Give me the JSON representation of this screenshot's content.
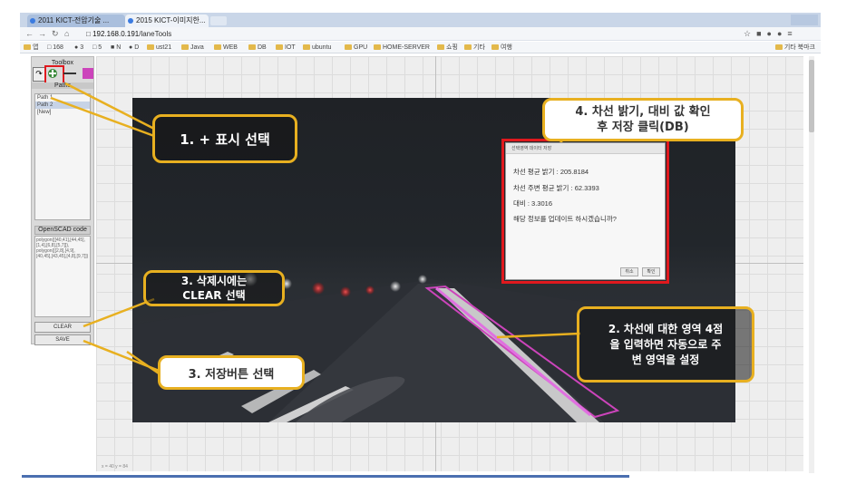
{
  "browser": {
    "tabs": [
      {
        "label": "2011 KICT-전압기술 ..."
      },
      {
        "label": "2015 KICT-이미지한..."
      }
    ],
    "url_host": "192.168.0.191",
    "url_path": "/laneTools",
    "bookmarks": [
      "앱",
      "168",
      "3",
      "5",
      "N",
      "D",
      "ust21",
      "Java",
      "WEB",
      "DB",
      "IOT",
      "ubuntu",
      "GPU",
      "HOME-SERVER",
      "쇼핑",
      "기타",
      "여행"
    ],
    "other_bookmarks": "기타 북마크"
  },
  "toolbox": {
    "title": "Toolbox",
    "paths_title": "Paths",
    "paths": [
      "Path 1",
      "Path 2",
      "[New]"
    ],
    "openscad_title": "OpenSCAD code",
    "openscad_code": "polygon([[40,41],[44,45],[1,4],[6,8],[5,7]]), polygon([[2,8],[4,9],[40,45],[43,45],[4,8],[9,7]])",
    "clear_label": "CLEAR",
    "save_label": "SAVE"
  },
  "canvas": {
    "coord_readout": "x = 40  y = 84"
  },
  "callouts": {
    "c1": "1. + 표시 선택",
    "c4_line1": "4. 차선 밝기, 대비 값 확인",
    "c4_line2": "후 저장 클릭(DB)",
    "c3a_line1": "3. 삭제시에는",
    "c3a_line2": "CLEAR 선택",
    "c2_line1": "2.  차선에 대한 영역 4점",
    "c2_line2": "을 입력하면 자동으로 주",
    "c2_line3": "변 영역을 설정",
    "c3b": "3. 저장버튼 선택"
  },
  "dialog": {
    "title": "선택영역 데이터 저장",
    "line1": "차선 평균 밝기 : 205.8184",
    "line2": "차선 주변 평균 밝기 : 62.3393",
    "line3": "대비 : 3.3016",
    "line4": "해당 정보를 업데이트 하시겠습니까?",
    "cancel": "취소",
    "ok": "확인"
  },
  "colors": {
    "callout_border": "#e8b020",
    "highlight_red": "#e0191e",
    "lane_marker": "#cc44bb"
  }
}
